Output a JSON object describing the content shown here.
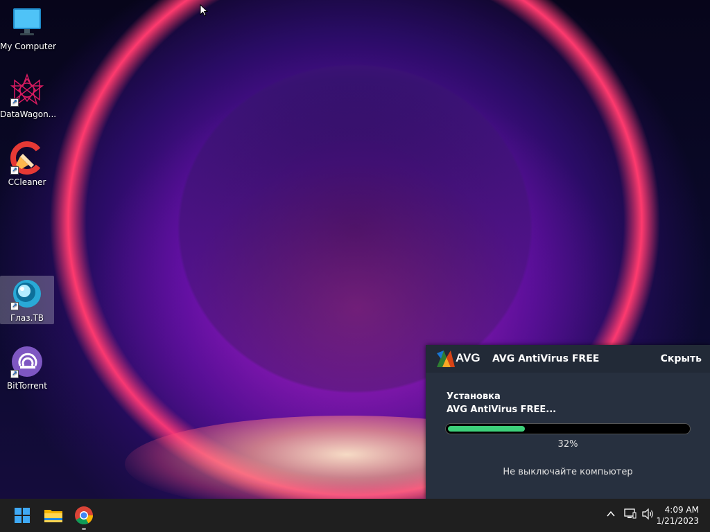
{
  "desktop": {
    "icons": [
      {
        "label": "My Computer",
        "icon": "computer-icon"
      },
      {
        "label": "DataWagon...",
        "icon": "datawagon-icon"
      },
      {
        "label": "CCleaner",
        "icon": "ccleaner-icon"
      },
      {
        "label": "Глаз.ТВ",
        "icon": "glaz-tv-icon"
      },
      {
        "label": "BitTorrent",
        "icon": "bittorrent-icon"
      }
    ]
  },
  "avg": {
    "logo_text": "AVG",
    "title": "AVG AntiVirus FREE",
    "hide_label": "Скрыть",
    "status_line1": "Установка",
    "status_line2": "AVG AntiVirus FREE...",
    "progress": 0.32,
    "progress_label": "32%",
    "note": "Не выключайте компьютер",
    "accent": "#3dd07a"
  },
  "taskbar": {
    "pinned": [
      {
        "name": "start",
        "icon": "windows-start-icon"
      },
      {
        "name": "file-explorer",
        "icon": "folder-icon"
      },
      {
        "name": "chrome",
        "icon": "chrome-icon"
      }
    ],
    "tray_icons": [
      "chevron-up-icon",
      "network-icon",
      "volume-icon"
    ],
    "time": "4:09 AM",
    "date": "1/21/2023"
  }
}
